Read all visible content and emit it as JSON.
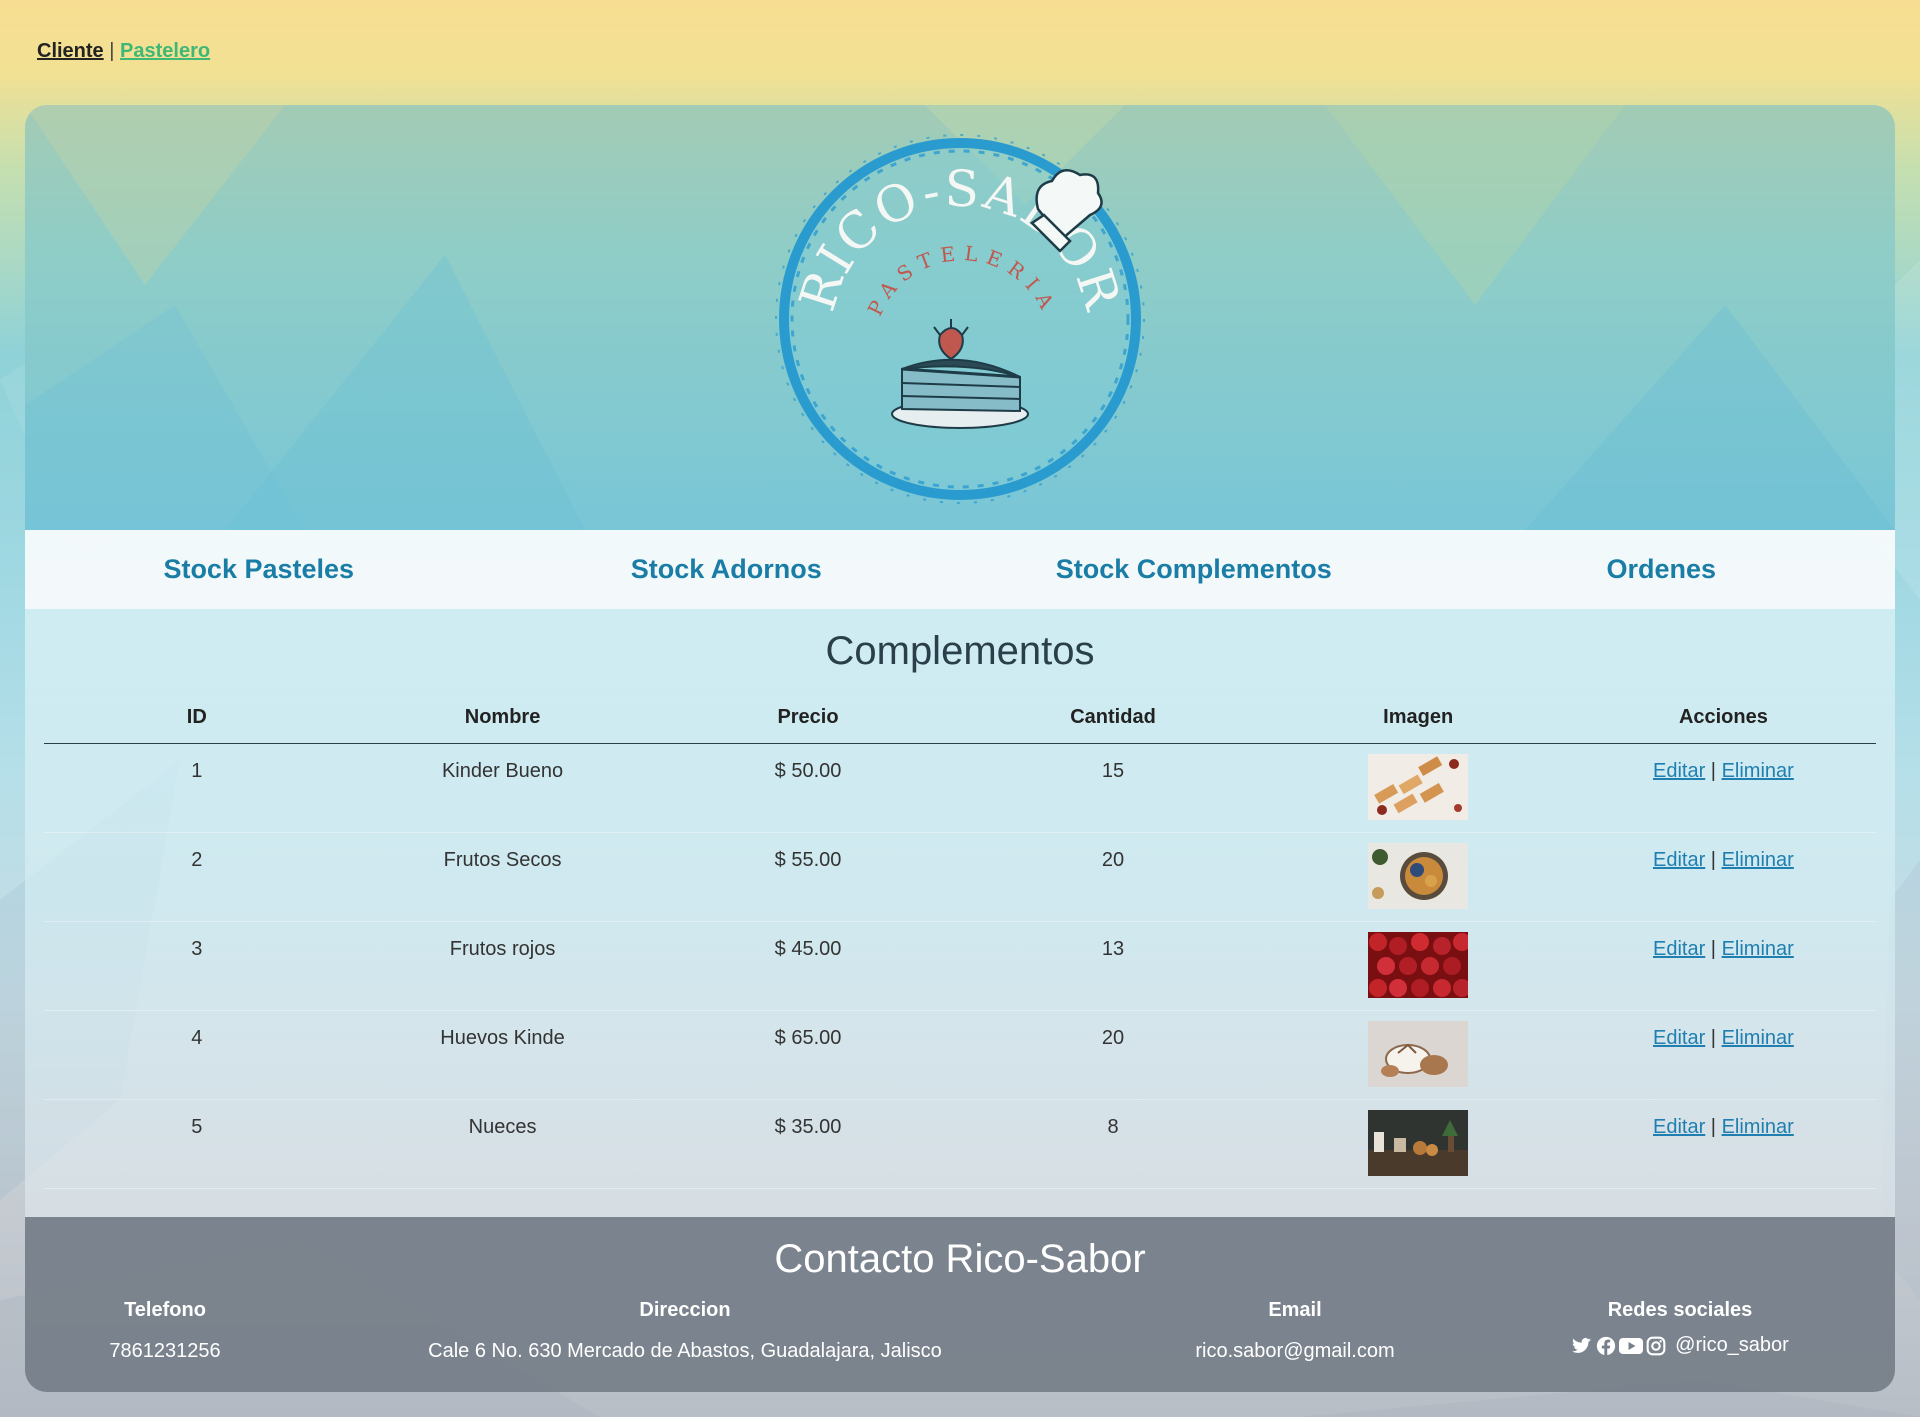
{
  "topnav": {
    "cliente": "Cliente",
    "separator": "|",
    "pastelero": "Pastelero"
  },
  "logo": {
    "brand": "RICO-SABOR",
    "subtitle": "PASTELERIA"
  },
  "menu": {
    "items": [
      {
        "label": "Stock Pasteles"
      },
      {
        "label": "Stock Adornos"
      },
      {
        "label": "Stock Complementos"
      },
      {
        "label": "Ordenes"
      }
    ]
  },
  "section": {
    "title": "Complementos"
  },
  "table": {
    "headers": [
      "ID",
      "Nombre",
      "Precio",
      "Cantidad",
      "Imagen",
      "Acciones"
    ],
    "rows": [
      {
        "id": "1",
        "nombre": "Kinder Bueno",
        "precio": "$ 50.00",
        "cantidad": "15",
        "image": "kinder-bueno-image",
        "editar": "Editar",
        "sep": "|",
        "eliminar": "Eliminar"
      },
      {
        "id": "2",
        "nombre": "Frutos Secos",
        "precio": "$ 55.00",
        "cantidad": "20",
        "image": "frutos-secos-image",
        "editar": "Editar",
        "sep": "|",
        "eliminar": "Eliminar"
      },
      {
        "id": "3",
        "nombre": "Frutos rojos",
        "precio": "$ 45.00",
        "cantidad": "13",
        "image": "frutos-rojos-image",
        "editar": "Editar",
        "sep": "|",
        "eliminar": "Eliminar"
      },
      {
        "id": "4",
        "nombre": "Huevos Kinde",
        "precio": "$ 65.00",
        "cantidad": "20",
        "image": "huevos-kinder-image",
        "editar": "Editar",
        "sep": "|",
        "eliminar": "Eliminar"
      },
      {
        "id": "5",
        "nombre": "Nueces",
        "precio": "$ 35.00",
        "cantidad": "8",
        "image": "nueces-image",
        "editar": "Editar",
        "sep": "|",
        "eliminar": "Eliminar"
      }
    ]
  },
  "footer": {
    "title": "Contacto Rico-Sabor",
    "telefono_label": "Telefono",
    "telefono": "7861231256",
    "direccion_label": "Direccion",
    "direccion": "Cale 6 No. 630 Mercado de Abastos, Guadalajara, Jalisco",
    "email_label": "Email",
    "email": "rico.sabor@gmail.com",
    "redes_label": "Redes sociales",
    "handle": "@rico_sabor",
    "social_icons": [
      "twitter-icon",
      "facebook-icon",
      "youtube-icon",
      "instagram-icon"
    ]
  },
  "colors": {
    "accent": "#1a7da6",
    "pastelero_link": "#3fb877",
    "footer_bg": "#77808a",
    "logo_ring": "#2a9bcf"
  }
}
